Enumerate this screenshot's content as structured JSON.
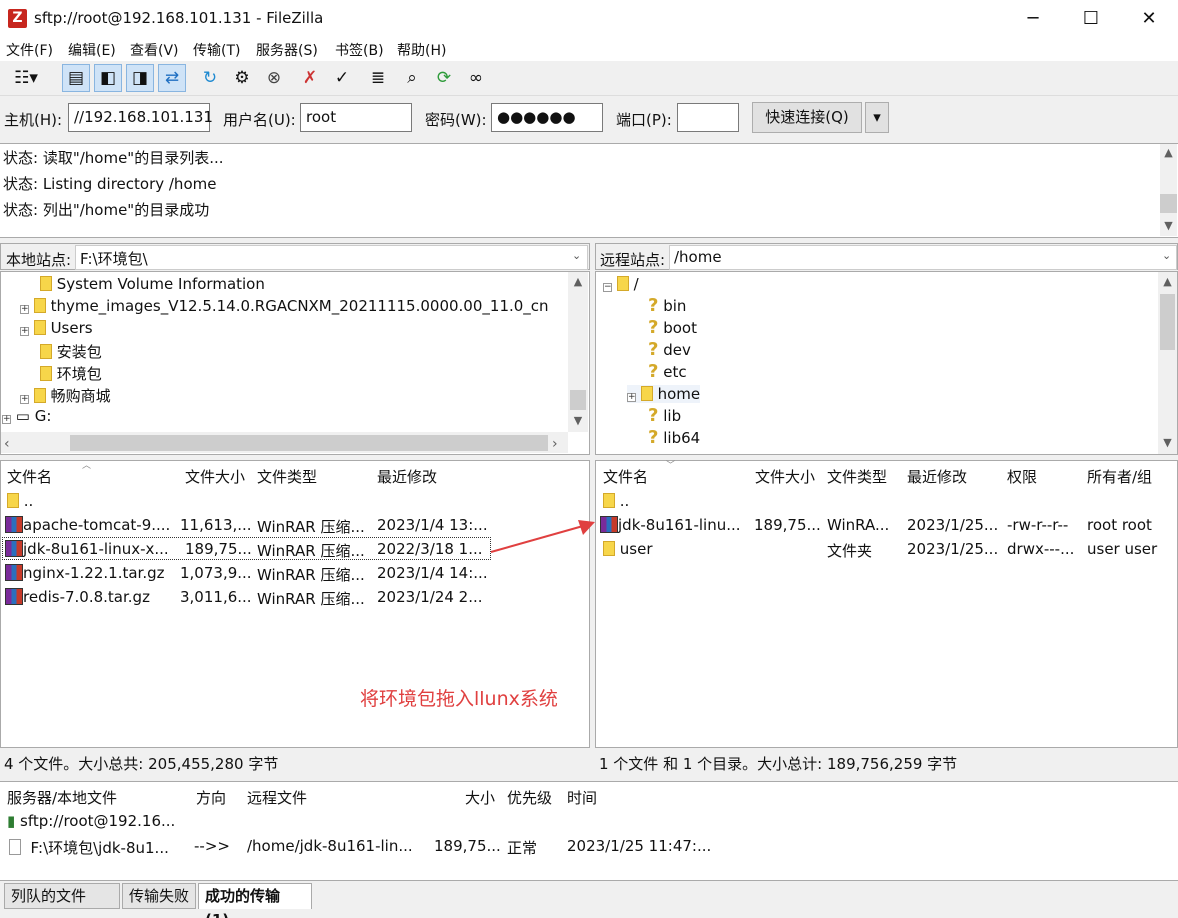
{
  "window": {
    "title": "sftp://root@192.168.101.131 - FileZilla",
    "minimize": "─",
    "maximize": "☐",
    "close": "✕"
  },
  "menu": [
    "文件(F)",
    "编辑(E)",
    "查看(V)",
    "传输(T)",
    "服务器(S)",
    "书签(B)",
    "帮助(H)"
  ],
  "quickconnect": {
    "host_label": "主机(H):",
    "host_value": "//192.168.101.131",
    "user_label": "用户名(U):",
    "user_value": "root",
    "pass_label": "密码(W):",
    "pass_value": "●●●●●●",
    "port_label": "端口(P):",
    "port_value": "",
    "connect_label": "快速连接(Q)"
  },
  "log": [
    "状态:  读取\"/home\"的目录列表...",
    "状态:  Listing directory /home",
    "状态:  列出\"/home\"的目录成功"
  ],
  "local": {
    "site_label": "本地站点:",
    "path": "F:\\环境包\\",
    "tree": [
      "System Volume Information",
      "thyme_images_V12.5.14.0.RGACNXM_20211115.0000.00_11.0_cn",
      "Users",
      "安装包",
      "环境包",
      "畅购商城",
      "G:"
    ],
    "headers": [
      "文件名",
      "文件大小",
      "文件类型",
      "最近修改"
    ],
    "files": [
      {
        "name": "..",
        "size": "",
        "type": "",
        "date": ""
      },
      {
        "name": "apache-tomcat-9....",
        "size": "11,613,...",
        "type": "WinRAR 压缩...",
        "date": "2023/1/4 13:..."
      },
      {
        "name": "jdk-8u161-linux-x...",
        "size": "189,75...",
        "type": "WinRAR 压缩...",
        "date": "2022/3/18 1..."
      },
      {
        "name": "nginx-1.22.1.tar.gz",
        "size": "1,073,9...",
        "type": "WinRAR 压缩...",
        "date": "2023/1/4 14:..."
      },
      {
        "name": "redis-7.0.8.tar.gz",
        "size": "3,011,6...",
        "type": "WinRAR 压缩...",
        "date": "2023/1/24 2..."
      }
    ],
    "status": "4 个文件。大小总共: 205,455,280 字节"
  },
  "remote": {
    "site_label": "远程站点:",
    "path": "/home",
    "tree": [
      "/",
      "bin",
      "boot",
      "dev",
      "etc",
      "home",
      "lib",
      "lib64"
    ],
    "headers": [
      "文件名",
      "文件大小",
      "文件类型",
      "最近修改",
      "权限",
      "所有者/组"
    ],
    "files": [
      {
        "name": "..",
        "size": "",
        "type": "",
        "date": "",
        "perm": "",
        "owner": ""
      },
      {
        "name": "jdk-8u161-linu...",
        "size": "189,75...",
        "type": "WinRA...",
        "date": "2023/1/25...",
        "perm": "-rw-r--r--",
        "owner": "root root"
      },
      {
        "name": "user",
        "size": "",
        "type": "文件夹",
        "date": "2023/1/25...",
        "perm": "drwx---...",
        "owner": "user user"
      }
    ],
    "status": "1 个文件 和 1 个目录。大小总计: 189,756,259 字节"
  },
  "annotation": "将环境包拖入llunx系统",
  "queue": {
    "headers": [
      "服务器/本地文件",
      "方向",
      "远程文件",
      "大小",
      "优先级",
      "时间"
    ],
    "server": "sftp://root@192.16...",
    "row": {
      "local": "F:\\环境包\\jdk-8u1...",
      "dir": "-->>",
      "remote": "/home/jdk-8u161-lin...",
      "size": "189,75...",
      "priority": "正常",
      "time": "2023/1/25 11:47:..."
    }
  },
  "tabs": [
    "列队的文件",
    "传输失败",
    "成功的传输 (1)"
  ],
  "colors": {
    "accent_red": "#e04040",
    "selection": "#cfe3f7"
  }
}
